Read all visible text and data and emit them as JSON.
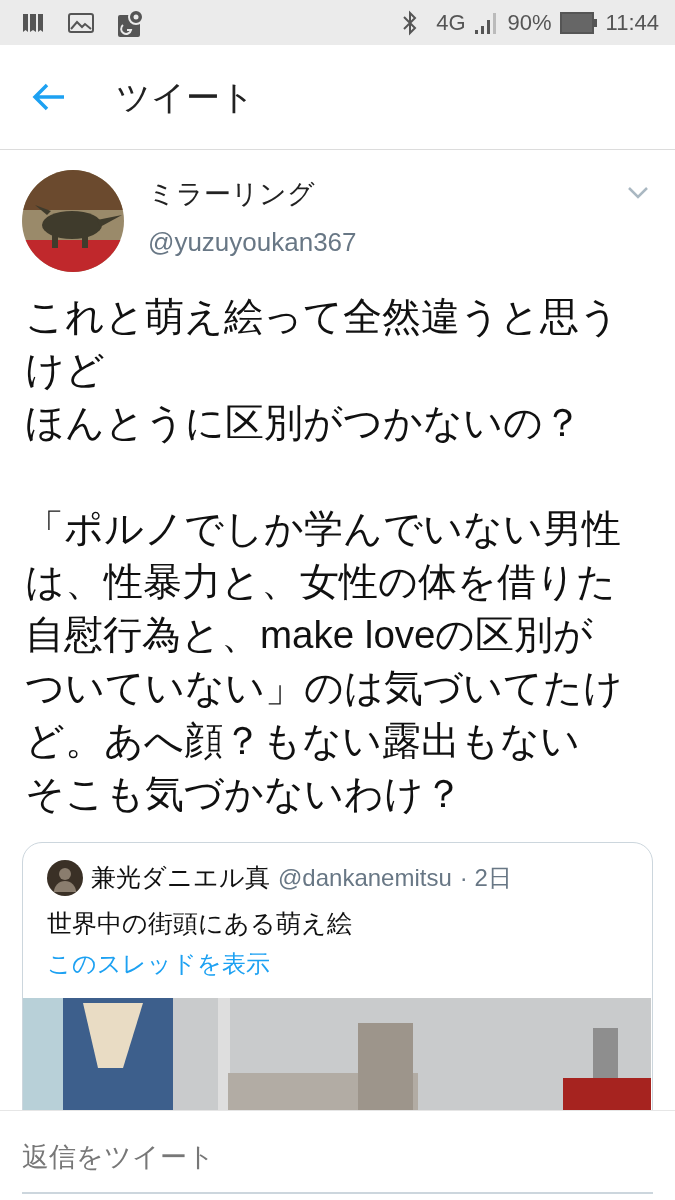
{
  "status_bar": {
    "network": "4G",
    "battery": "90%",
    "time": "11:44"
  },
  "header": {
    "title": "ツイート"
  },
  "tweet": {
    "name": "ミラーリング",
    "handle": "@yuzuyoukan367",
    "paragraphs": [
      "これと萌え絵って全然違うと思うけど",
      "ほんとうに区別がつかないの？",
      "「ポルノでしか学んでいない男性は、性暴力と、女性の体を借りた自慰行為と、make loveの区別がついていない」のは気づいてたけど。あへ顔？もない露出もない",
      "そこも気づかないわけ？"
    ]
  },
  "quoted_tweet": {
    "name": "兼光ダニエル真",
    "handle": "@dankanemitsu",
    "time": "· 2日",
    "text": "世界中の街頭にある萌え絵",
    "link": "このスレッドを表示"
  },
  "reply": {
    "placeholder": "返信をツイート"
  }
}
